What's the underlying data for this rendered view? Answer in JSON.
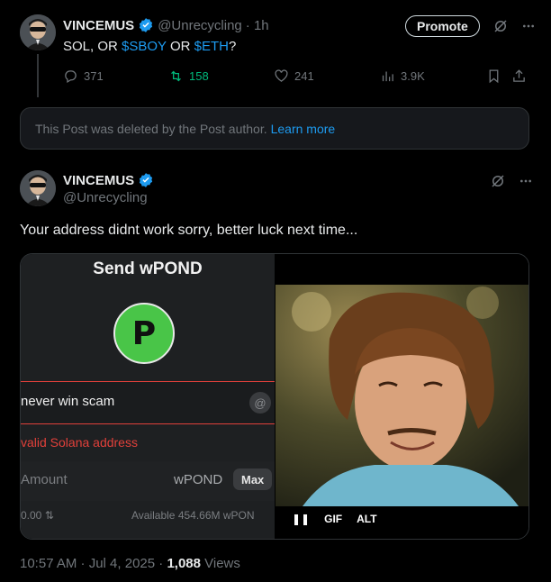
{
  "original_post": {
    "display_name": "VINCEMUS",
    "handle": "@Unrecycling",
    "time": "· 1h",
    "text_parts": [
      "SOL, OR ",
      "$SBOY",
      " OR ",
      "$ETH",
      "?"
    ],
    "promote_label": "Promote",
    "metrics": {
      "replies": "371",
      "reposts": "158",
      "likes": "241",
      "views": "3.9K"
    }
  },
  "deleted_notice": {
    "text": "This Post was deleted by the Post author.",
    "link": "Learn more"
  },
  "reply_post": {
    "display_name": "VINCEMUS",
    "handle": "@Unrecycling",
    "text": "Your address didnt work sorry, better luck next time...",
    "media": {
      "screenshot": {
        "title": "Send wPOND",
        "logo_letter": "P",
        "address_value": "never win scam",
        "error": "valid Solana address",
        "amount_placeholder": "Amount",
        "token": "wPOND",
        "max_label": "Max",
        "balance_left": "0.00 ⇅",
        "balance_right": "Available 454.66M wPON"
      },
      "gif_controls": {
        "pause": "❚❚",
        "gif": "GIF",
        "alt": "ALT"
      }
    },
    "footer": {
      "time": "10:57 AM · Jul 4, 2025 · ",
      "views_count": "1,088",
      "views_label": " Views"
    }
  },
  "colors": {
    "accent": "#1d9bf0",
    "repost": "#00ba7c",
    "error": "#e0403a",
    "logo_green": "#49c548"
  }
}
